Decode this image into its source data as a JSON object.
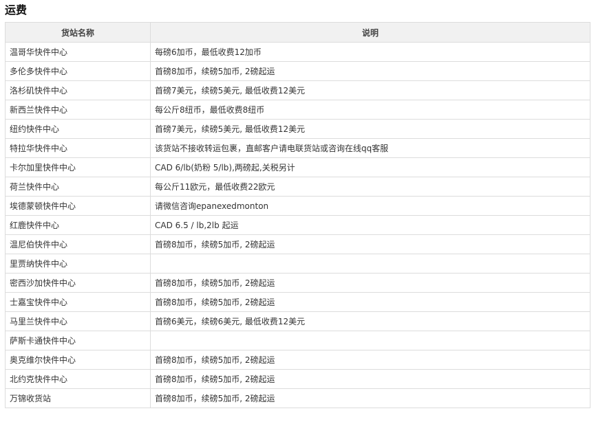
{
  "page": {
    "title": "运费"
  },
  "table": {
    "headers": [
      "货站名称",
      "说明"
    ],
    "rows": [
      {
        "station": "温哥华快件中心",
        "note": "每磅6加币，最低收费12加币"
      },
      {
        "station": "多伦多快件中心",
        "note": "首磅8加币，续磅5加币, 2磅起运"
      },
      {
        "station": "洛杉矶快件中心",
        "note": "首磅7美元，续磅5美元, 最低收费12美元"
      },
      {
        "station": "新西兰快件中心",
        "note": "每公斤8纽币，最低收费8纽币"
      },
      {
        "station": "纽约快件中心",
        "note": "首磅7美元，续磅5美元, 最低收费12美元"
      },
      {
        "station": "特拉华快件中心",
        "note": "该货站不接收转运包裹，直邮客户请电联货站或咨询在线qq客服"
      },
      {
        "station": "卡尔加里快件中心",
        "note": "CAD 6/lb(奶粉 5/lb),两磅起,关税另计"
      },
      {
        "station": "荷兰快件中心",
        "note": "每公斤11欧元，最低收费22欧元"
      },
      {
        "station": "埃德蒙顿快件中心",
        "note": "请微信咨询epanexedmonton"
      },
      {
        "station": "红鹿快件中心",
        "note": "CAD 6.5 / lb,2lb 起运"
      },
      {
        "station": "温尼伯快件中心",
        "note": "首磅8加币，续磅5加币, 2磅起运"
      },
      {
        "station": "里贾纳快件中心",
        "note": ""
      },
      {
        "station": "密西沙加快件中心",
        "note": "首磅8加币，续磅5加币, 2磅起运"
      },
      {
        "station": "士嘉宝快件中心",
        "note": "首磅8加币，续磅5加币, 2磅起运"
      },
      {
        "station": "马里兰快件中心",
        "note": "首磅6美元，续磅6美元, 最低收费12美元"
      },
      {
        "station": "萨斯卡通快件中心",
        "note": ""
      },
      {
        "station": "奥克维尔快件中心",
        "note": "首磅8加币，续磅5加币, 2磅起运"
      },
      {
        "station": "北约克快件中心",
        "note": "首磅8加币，续磅5加币, 2磅起运"
      },
      {
        "station": "万锦收货站",
        "note": "首磅8加币，续磅5加币, 2磅起运"
      }
    ]
  }
}
